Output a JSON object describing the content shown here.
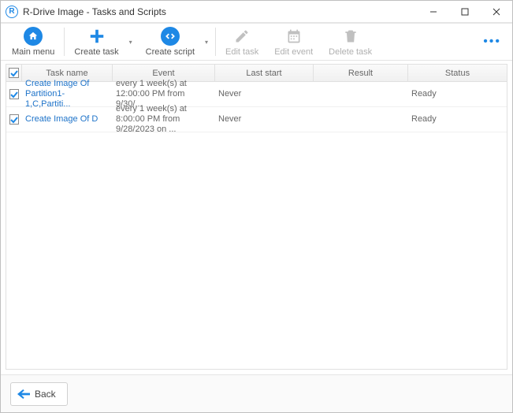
{
  "window": {
    "app_icon_letter": "R",
    "title": "R-Drive Image - Tasks and Scripts"
  },
  "toolbar": {
    "main_menu": "Main menu",
    "create_task": "Create task",
    "create_script": "Create script",
    "edit_task": "Edit task",
    "edit_event": "Edit event",
    "delete_task": "Delete task"
  },
  "grid": {
    "headers": {
      "task_name": "Task name",
      "event": "Event",
      "last_start": "Last start",
      "result": "Result",
      "status": "Status"
    },
    "rows": [
      {
        "checked": true,
        "name": "Create Image Of Partition1-1,C,Partiti...",
        "event": "every 1 week(s) at 12:00:00 PM from 9/30/...",
        "last": "Never",
        "result": "",
        "status": "Ready"
      },
      {
        "checked": true,
        "name": "Create Image Of D",
        "event": "every 1 week(s) at 8:00:00 PM from 9/28/2023 on ...",
        "last": "Never",
        "result": "",
        "status": "Ready"
      }
    ]
  },
  "footer": {
    "back": "Back"
  }
}
